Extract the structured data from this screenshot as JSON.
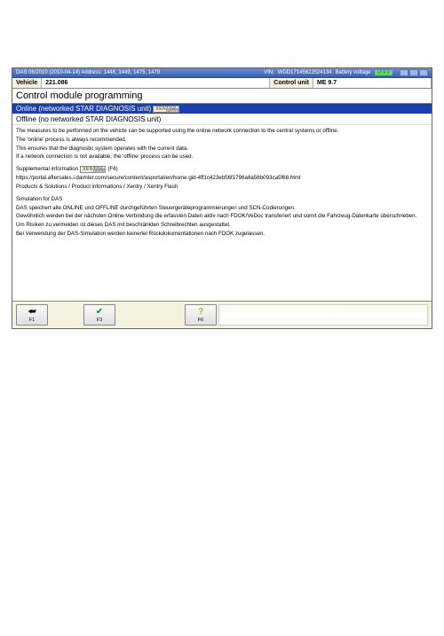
{
  "titlebar": {
    "left": "DAS 06/2010 (2010-04-14) Address: 1446, 1449, 1475, 1479",
    "vin_label": "VIN:",
    "vin_value": "WDD1714562J524134",
    "battery_label": "Battery voltage",
    "battery_value": "12.6 V"
  },
  "header": {
    "vehicle_label": "Vehicle",
    "vehicle_value": "221.086",
    "control_unit_label": "Control unit",
    "control_unit_value": "ME 9.7"
  },
  "section_title": "Control module programming",
  "options": {
    "online": "Online (networked STAR DIAGNOSIS unit)",
    "offline": "Offline (no networked STAR DIAGNOSIS unit)",
    "xentry_label": "XENTRY",
    "xentry_flash": "Flash"
  },
  "body": {
    "p1": "The measures to be performed on the vehicle can be supported using the online network connection to the central systems or offline.",
    "p2": "The 'online' process is always recommended.",
    "p3": "This ensures that the diagnostic system operates with the current data.",
    "p4": "If a network connection is not available, the 'offline' process can be used.",
    "supp_label": "Supplemental information",
    "supp_hint": "(F6)",
    "url": "https://portal.aftersales.i.daimler.com/secure/content/asportal/en/home.gid-4ff1c423eb56f1796a8a56b093ca5f68.html",
    "path": "Products & Solutions / Product informations / Xentry / Xentry Flash",
    "sim_title": "Simulation for DAS",
    "sim_p1": "DAS speichert alle ONLINE und OFFLINE durchgeführten Steuergeräteprogrammierungen und SCN-Codierungen.",
    "sim_p2": "Gewöhnlich werden bei der nächsten Online-Verbindung die erfassten Daten aktiv nach FDOK/VeDoc transferiert und somit die Fahrzeug-Datenkarte überschrieben.",
    "sim_p3": "Um Risiken zu vermeiden ist dieses DAS mit beschränkten Schreibrechten ausgestattet.",
    "sim_p4": "Bei Verwendung der DAS-Simulation werden keinerlei Rückdokumentationen nach FDOK zugelassen."
  },
  "fkeys": {
    "f1": "F1",
    "f3": "F3",
    "f6": "F6"
  },
  "icons": {
    "back": "⮨",
    "check": "✔",
    "help": "?"
  }
}
